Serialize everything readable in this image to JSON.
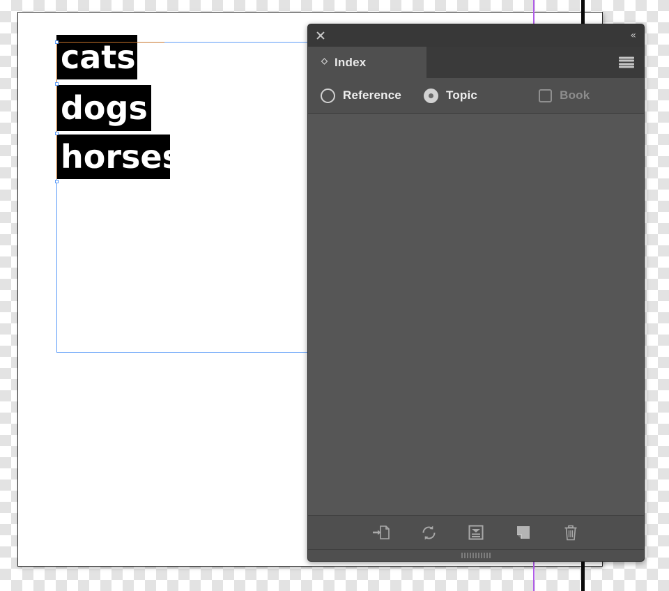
{
  "document": {
    "text_frames": [
      {
        "text": "cats",
        "icon": "text-frame"
      },
      {
        "text": "dogs",
        "icon": "text-frame"
      },
      {
        "text": "horses",
        "icon": "text-frame"
      }
    ],
    "guides": {
      "margin_guide_color": "#5b9bf8",
      "frame_outline_color": "#c8742a",
      "ruler_guide_purple": "#b05ce8",
      "ruler_guide_black": "#0a0a0a"
    },
    "page_background": "#ffffff"
  },
  "panel": {
    "titlebar": {
      "close_icon": "close-icon",
      "collapse_label": "«",
      "collapse_icon": "double-chevron-left-icon"
    },
    "tab": {
      "label": "Index",
      "diamond_icon": "diamond-icon",
      "menu_icon": "hamburger-menu-icon"
    },
    "options": [
      {
        "id": "reference",
        "label": "Reference",
        "control": "radio",
        "selected": false,
        "disabled": false
      },
      {
        "id": "topic",
        "label": "Topic",
        "control": "radio",
        "selected": true,
        "disabled": false
      },
      {
        "id": "book",
        "label": "Book",
        "control": "checkbox",
        "selected": false,
        "disabled": true
      }
    ],
    "list": {
      "entries": [],
      "background": "#565656"
    },
    "toolbar": [
      {
        "id": "import-topics",
        "icon": "import-to-page-icon",
        "title": "Import Topics"
      },
      {
        "id": "update-preview",
        "icon": "refresh-sync-icon",
        "title": "Update Preview"
      },
      {
        "id": "generate-index",
        "icon": "generate-index-icon",
        "title": "Generate Index"
      },
      {
        "id": "create-new-index-entry",
        "icon": "new-page-entry-icon",
        "title": "Create a new index entry"
      },
      {
        "id": "delete-entry",
        "icon": "trash-icon",
        "title": "Delete Selected Entry"
      }
    ],
    "grip": {
      "icon": "resize-grip-icon"
    },
    "colors": {
      "panel_bg": "#4f4f4f",
      "titlebar_bg": "#383838",
      "tabstrip_bg": "#3a3a3a",
      "list_bg": "#565656",
      "text": "#efefef",
      "text_disabled": "#8d8d8d"
    }
  }
}
